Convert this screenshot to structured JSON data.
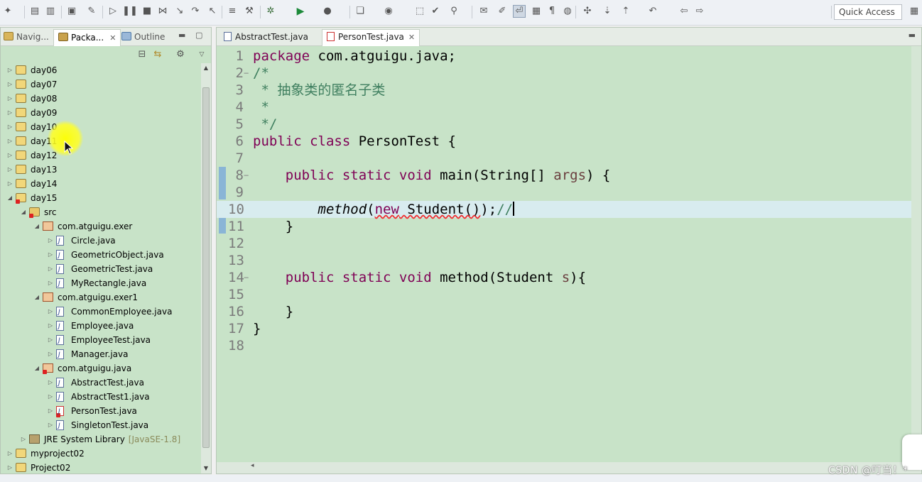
{
  "toolbar": {
    "quick_access": "Quick Access",
    "icons": [
      "new-icon",
      "save-icon",
      "save-all-icon",
      "terminal-icon",
      "skip-breakpoints-icon",
      "resume-icon",
      "suspend-icon",
      "terminate-icon",
      "disconnect-icon",
      "step-into-icon",
      "step-over-icon",
      "step-return-icon",
      "format-icon",
      "refactor-icon",
      "debug-icon",
      "run-icon",
      "run-external-icon",
      "new-java-project-icon",
      "new-class-icon",
      "open-type-icon",
      "open-task-icon",
      "search-icon",
      "annotation-icon",
      "mark-occurrences-icon",
      "word-wrap-icon",
      "block-selection-icon",
      "show-whitespace-icon",
      "web-browser-icon",
      "java-browsing-icon",
      "next-annotation-icon",
      "prev-annotation-icon",
      "last-edit-icon",
      "back-icon",
      "forward-icon"
    ]
  },
  "left_view": {
    "tabs": [
      {
        "label": "Navig..."
      },
      {
        "label": "Packa..."
      },
      {
        "label": "Outline"
      }
    ],
    "tree": [
      {
        "label": "day06",
        "type": "proj",
        "depth": 0,
        "twisty": "▷"
      },
      {
        "label": "day07",
        "type": "proj",
        "depth": 0,
        "twisty": "▷"
      },
      {
        "label": "day08",
        "type": "proj",
        "depth": 0,
        "twisty": "▷"
      },
      {
        "label": "day09",
        "type": "proj",
        "depth": 0,
        "twisty": "▷"
      },
      {
        "label": "day10",
        "type": "proj",
        "depth": 0,
        "twisty": "▷"
      },
      {
        "label": "day11",
        "type": "proj",
        "depth": 0,
        "twisty": "▷"
      },
      {
        "label": "day12",
        "type": "proj",
        "depth": 0,
        "twisty": "▷"
      },
      {
        "label": "day13",
        "type": "proj",
        "depth": 0,
        "twisty": "▷"
      },
      {
        "label": "day14",
        "type": "proj",
        "depth": 0,
        "twisty": "▷"
      },
      {
        "label": "day15",
        "type": "proj",
        "depth": 0,
        "twisty": "◢",
        "error": true
      },
      {
        "label": "src",
        "type": "src",
        "depth": 1,
        "twisty": "◢",
        "error": true
      },
      {
        "label": "com.atguigu.exer",
        "type": "pkg",
        "depth": 2,
        "twisty": "◢"
      },
      {
        "label": "Circle.java",
        "type": "java",
        "depth": 3,
        "twisty": "▷"
      },
      {
        "label": "GeometricObject.java",
        "type": "java",
        "depth": 3,
        "twisty": "▷"
      },
      {
        "label": "GeometricTest.java",
        "type": "java",
        "depth": 3,
        "twisty": "▷"
      },
      {
        "label": "MyRectangle.java",
        "type": "java",
        "depth": 3,
        "twisty": "▷"
      },
      {
        "label": "com.atguigu.exer1",
        "type": "pkg",
        "depth": 2,
        "twisty": "◢"
      },
      {
        "label": "CommonEmployee.java",
        "type": "java",
        "depth": 3,
        "twisty": "▷"
      },
      {
        "label": "Employee.java",
        "type": "java",
        "depth": 3,
        "twisty": "▷"
      },
      {
        "label": "EmployeeTest.java",
        "type": "java",
        "depth": 3,
        "twisty": "▷"
      },
      {
        "label": "Manager.java",
        "type": "java",
        "depth": 3,
        "twisty": "▷"
      },
      {
        "label": "com.atguigu.java",
        "type": "pkg",
        "depth": 2,
        "twisty": "◢",
        "error": true
      },
      {
        "label": "AbstractTest.java",
        "type": "java",
        "depth": 3,
        "twisty": "▷"
      },
      {
        "label": "AbstractTest1.java",
        "type": "java",
        "depth": 3,
        "twisty": "▷"
      },
      {
        "label": "PersonTest.java",
        "type": "java",
        "depth": 3,
        "twisty": "▷",
        "error": true
      },
      {
        "label": "SingletonTest.java",
        "type": "java",
        "depth": 3,
        "twisty": "▷"
      },
      {
        "label": "JRE System Library",
        "type": "lib",
        "depth": 1,
        "twisty": "▷",
        "decoration": "[JavaSE-1.8]"
      },
      {
        "label": "myproject02",
        "type": "proj",
        "depth": 0,
        "twisty": "▷"
      },
      {
        "label": "Project02",
        "type": "proj",
        "depth": 0,
        "twisty": "▷"
      }
    ]
  },
  "editor": {
    "tabs": [
      {
        "label": "AbstractTest.java",
        "active": false
      },
      {
        "label": "PersonTest.java",
        "active": true
      }
    ],
    "current_line": 10,
    "lines": [
      {
        "n": "1",
        "html": "<span class=\"kw\">package</span> com.atguigu.java;"
      },
      {
        "n": "2",
        "fold": "−",
        "html": "<span class=\"cm\">/*</span>"
      },
      {
        "n": "3",
        "html": "<span class=\"cm\"> * 抽象类的匿名子类</span>"
      },
      {
        "n": "4",
        "html": "<span class=\"cm\"> *</span>"
      },
      {
        "n": "5",
        "html": "<span class=\"cm\"> */</span>"
      },
      {
        "n": "6",
        "html": "<span class=\"kw\">public class</span> PersonTest {"
      },
      {
        "n": "7",
        "html": ""
      },
      {
        "n": "8",
        "fold": "−",
        "html": "    <span class=\"kw\">public static void</span> main(String[] <span class=\"ar\">args</span>) {"
      },
      {
        "n": "9",
        "html": ""
      },
      {
        "n": "10",
        "html": "        <span class=\"it\">method</span>(<span class=\"squig\"><span class=\"kw\">new</span> Student()</span>);<span class=\"cm\">//</span><span class=\"caret\"></span>"
      },
      {
        "n": "11",
        "html": "    }"
      },
      {
        "n": "12",
        "html": ""
      },
      {
        "n": "13",
        "html": ""
      },
      {
        "n": "14",
        "fold": "−",
        "html": "    <span class=\"kw\">public static void</span> method(Student <span class=\"ar\">s</span>){"
      },
      {
        "n": "15",
        "html": ""
      },
      {
        "n": "16",
        "html": "    }"
      },
      {
        "n": "17",
        "html": "}"
      },
      {
        "n": "18",
        "html": ""
      }
    ]
  },
  "watermark": "CSDN @叮当！*",
  "colors": {
    "editor_bg": "#c8e3c8",
    "keyword": "#7f0055",
    "comment": "#3f7f5f",
    "current_line": "#d8ecef"
  }
}
